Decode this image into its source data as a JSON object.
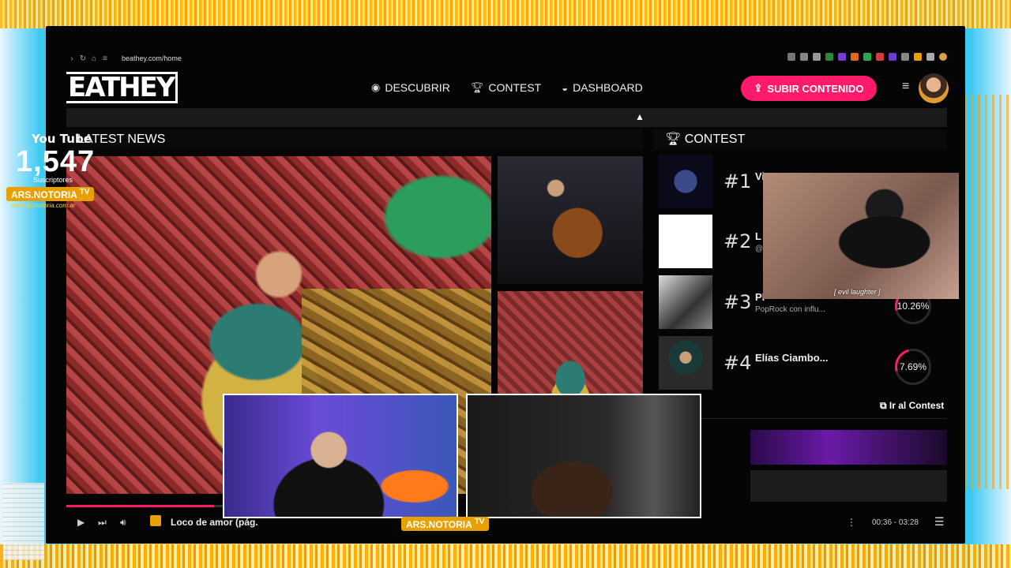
{
  "browser": {
    "url": "beathey.com/home"
  },
  "header": {
    "logo": "EATHEY",
    "menu": [
      {
        "label": "DESCUBRIR",
        "icon": "compass-icon"
      },
      {
        "label": "CONTEST",
        "icon": "trophy-icon"
      },
      {
        "label": "DASHBOARD",
        "icon": "gauge-icon"
      }
    ],
    "upload_label": "SUBIR CONTENIDO"
  },
  "news": {
    "title": "LATEST NEWS"
  },
  "youtube": {
    "label": "You Tube",
    "count": "1,547",
    "sub_label": "Suscriptores",
    "brand": "ARS.NOTORIA",
    "brand_tv": "TV",
    "url": "www.arsnotoria.com.ar"
  },
  "contest": {
    "title": "CONTEST",
    "entries": [
      {
        "rank": "#1",
        "name": "Vi",
        "desc": "",
        "pct": ""
      },
      {
        "rank": "#2",
        "name": "L",
        "desc": "@",
        "pct": ""
      },
      {
        "rank": "#3",
        "name": "Pl",
        "desc": "PopRock con influ...",
        "pct": "10.26%"
      },
      {
        "rank": "#4",
        "name": "Elías Ciambo...",
        "desc": "",
        "pct": "7.69%"
      }
    ],
    "link": "Ir al Contest"
  },
  "overlay_caption": "[ evil laughter ]",
  "player": {
    "track": "Loco de amor (pág.",
    "time": "00:36 - 03:28",
    "progress": 0.74
  },
  "stream_brand": "ARS.NOTORIA",
  "stream_brand_tv": "TV",
  "colors": {
    "accent": "#ff1a6c",
    "brand": "#e8a000"
  }
}
